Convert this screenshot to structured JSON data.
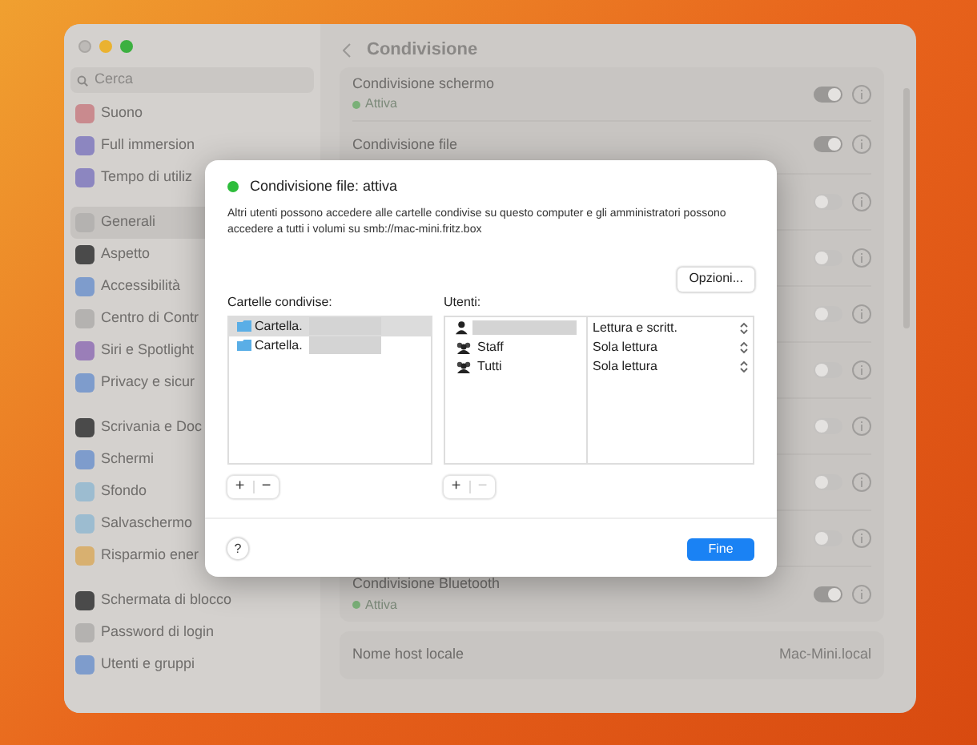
{
  "sidebar": {
    "search": {
      "placeholder": "Cerca"
    },
    "groups": [
      [
        {
          "label": "Suono",
          "selected": false,
          "color": "#c98a8e"
        },
        {
          "label": "Full immersion",
          "selected": false,
          "color": "#8c86c0"
        },
        {
          "label": "Tempo di utiliz",
          "selected": false,
          "color": "#8c86c0"
        }
      ],
      [
        {
          "label": "Generali",
          "selected": true,
          "color": "#b4b2b0"
        },
        {
          "label": "Aspetto",
          "selected": false,
          "color": "#4a4a4a"
        },
        {
          "label": "Accessibilità",
          "selected": false,
          "color": "#7e9ccc"
        },
        {
          "label": "Centro di Contr",
          "selected": false,
          "color": "#b4b2b0"
        },
        {
          "label": "Siri e Spotlight",
          "selected": false,
          "color": "#9a7eb8"
        },
        {
          "label": "Privacy e sicur",
          "selected": false,
          "color": "#7e9ccc"
        }
      ],
      [
        {
          "label": "Scrivania e Doc",
          "selected": false,
          "color": "#4a4a4a"
        },
        {
          "label": "Schermi",
          "selected": false,
          "color": "#7e9ccc"
        },
        {
          "label": "Sfondo",
          "selected": false,
          "color": "#9cbcd0"
        },
        {
          "label": "Salvaschermo",
          "selected": false,
          "color": "#9cbcd0"
        },
        {
          "label": "Risparmio ener",
          "selected": false,
          "color": "#d8b070"
        }
      ],
      [
        {
          "label": "Schermata di blocco",
          "selected": false,
          "color": "#4a4a4a"
        },
        {
          "label": "Password di login",
          "selected": false,
          "color": "#b4b2b0"
        },
        {
          "label": "Utenti e gruppi",
          "selected": false,
          "color": "#7e9ccc"
        }
      ]
    ]
  },
  "header": {
    "title": "Condivisione"
  },
  "services": [
    {
      "name": "Condivisione schermo",
      "status": "Attiva",
      "on": true
    },
    {
      "name": "Condivisione file",
      "on": true
    },
    {
      "on": false
    },
    {
      "on": false
    },
    {
      "on": false
    },
    {
      "on": false
    },
    {
      "on": false
    },
    {
      "on": false
    },
    {
      "on": false
    },
    {
      "name": "Condivisione Bluetooth",
      "status": "Attiva",
      "on": true
    }
  ],
  "host": {
    "label": "Nome host locale",
    "value": "Mac-Mini.local"
  },
  "dialog": {
    "status": "Condivisione file: attiva",
    "active": true,
    "description": "Altri utenti possono accedere alle cartelle condivise su questo computer e gli amministratori possono accedere a tutti i volumi su smb://mac-mini.fritz.box",
    "options_button": "Opzioni...",
    "folders": {
      "title": "Cartelle condivise:",
      "items": [
        {
          "name": "Cartella.",
          "selected": true
        },
        {
          "name": "Cartella.",
          "selected": false
        }
      ],
      "add": "+",
      "remove": "−",
      "remove_disabled": false
    },
    "users": {
      "title": "Utenti:",
      "items": [
        {
          "kind": "user",
          "permission": "Lettura e scritt."
        },
        {
          "kind": "group",
          "name": "Staff",
          "permission": "Sola lettura"
        },
        {
          "kind": "group",
          "name": "Tutti",
          "permission": "Sola lettura"
        }
      ],
      "add": "+",
      "remove": "−",
      "remove_disabled": true
    },
    "help_button": "?",
    "done_button": "Fine"
  }
}
